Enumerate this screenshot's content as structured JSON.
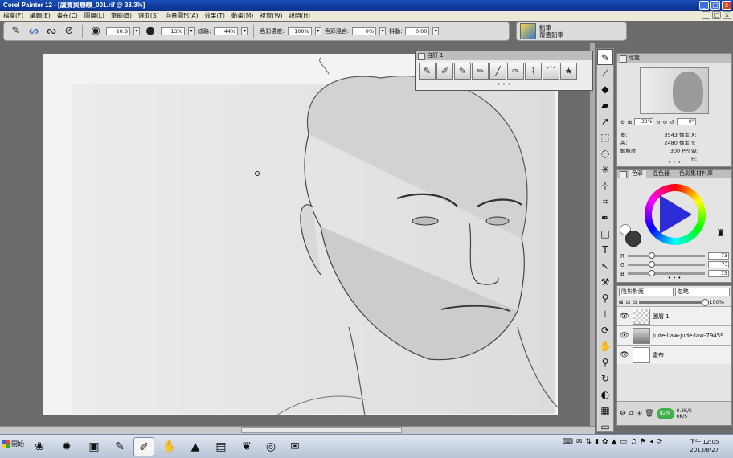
{
  "window": {
    "title": "Corel Painter 12 - [盧寶與戀戀_001.rif @ 33.3%]",
    "controls": [
      "_",
      "□",
      "x"
    ]
  },
  "menu": {
    "items": [
      "檔案(F)",
      "編輯(E)",
      "畫布(C)",
      "圖層(L)",
      "筆刷(B)",
      "選取(S)",
      "向量圖形(A)",
      "效果(T)",
      "動畫(M)",
      "視窗(W)",
      "說明(H)"
    ]
  },
  "property_bar": {
    "size_value": "20.8",
    "opacity_value": "13%",
    "grain_label": "紋路:",
    "grain_value": "44%",
    "color_variability_label": "色彩濃度:",
    "color_variability_value": "100%",
    "color_mix_label": "色彩混合:",
    "color_mix_value": "0%",
    "jitter_label": "抖動:",
    "jitter_value": "0.00"
  },
  "brush_selector": {
    "category": "鉛筆",
    "variant": "覆蓋鉛筆"
  },
  "brush_palette": {
    "title": "自訂 1",
    "grip": "• • •"
  },
  "navigator": {
    "title": "導覽",
    "zoom_value": "33%",
    "rotate_value": "0°",
    "width_label": "寬:",
    "width_value": "3543 像素",
    "height_label": "高:",
    "height_value": "2480 像素",
    "resolution_label": "解析度:",
    "resolution_value": "300 PPI",
    "x_label": "X:",
    "y_label": "Y:",
    "w_label": "W:",
    "h_label": "H:",
    "grip": "• • •"
  },
  "color_panel": {
    "tabs": [
      "色彩",
      "混色器",
      "色彩集材料庫"
    ],
    "r_label": "R",
    "g_label": "G",
    "b_label": "B",
    "r_value": "73",
    "g_value": "73",
    "b_value": "73",
    "main_color": "#3a3a3a",
    "grip": "• • •"
  },
  "layers_panel": {
    "composite_method": "陰影對應",
    "preserve": "忽略",
    "opacity": "100%",
    "layers": [
      {
        "name": "圖層 1",
        "thumb": "checker"
      },
      {
        "name": "Jude-Law-jude-law-79459",
        "thumb": "image"
      },
      {
        "name": "畫布",
        "thumb": "blank"
      }
    ],
    "memory_percent": "82%",
    "memory_a": "0.3K/S",
    "memory_b": "0K/S"
  },
  "taskbar": {
    "start_label": "開始",
    "clock_time": "下午 12:05",
    "clock_date": "2013/8/27"
  }
}
